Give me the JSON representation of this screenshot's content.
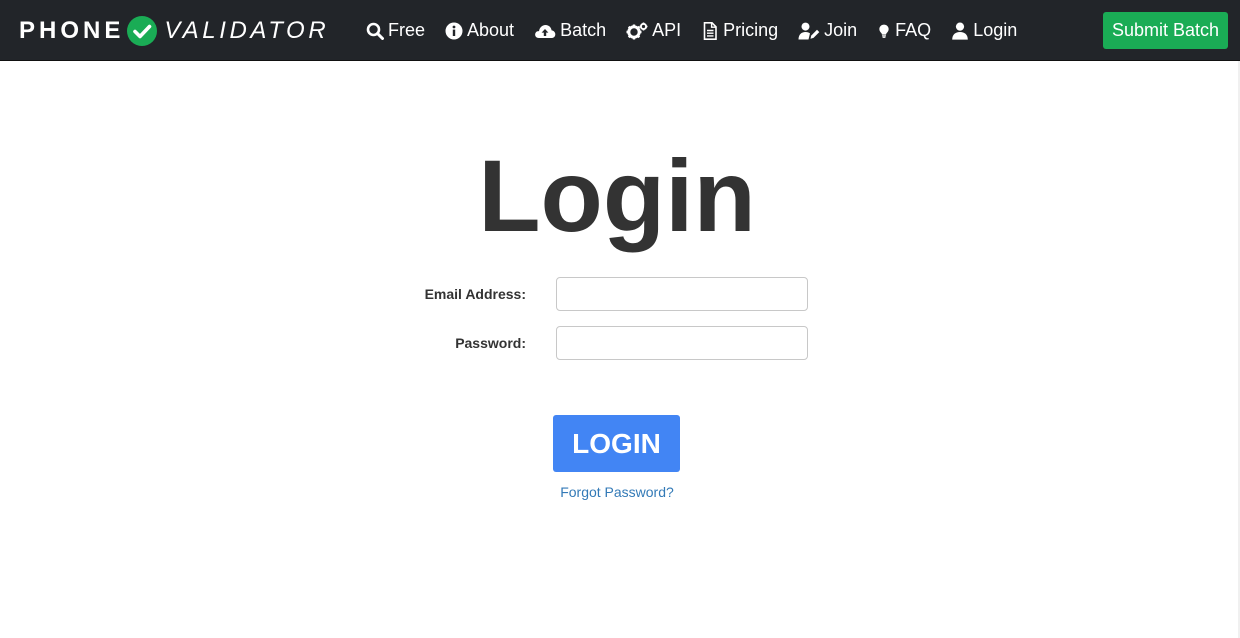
{
  "brand": {
    "word1": "PHONE",
    "word2": "VALIDATOR",
    "check_color": "#1aac55"
  },
  "nav": {
    "items": [
      {
        "label": "Free",
        "icon": "search-icon"
      },
      {
        "label": "About",
        "icon": "info-icon"
      },
      {
        "label": "Batch",
        "icon": "cloud-upload-icon"
      },
      {
        "label": "API",
        "icon": "cogs-icon"
      },
      {
        "label": "Pricing",
        "icon": "document-icon"
      },
      {
        "label": "Join",
        "icon": "user-edit-icon"
      },
      {
        "label": "FAQ",
        "icon": "lightbulb-icon"
      },
      {
        "label": "Login",
        "icon": "user-icon"
      }
    ],
    "submit_batch": "Submit Batch",
    "colors": {
      "bar": "#222529",
      "submit": "#1aac55"
    }
  },
  "page": {
    "title": "Login"
  },
  "form": {
    "email_label": "Email Address:",
    "email_value": "",
    "password_label": "Password:",
    "password_value": "",
    "login_button": "LOGIN",
    "forgot_link": "Forgot Password?"
  },
  "colors": {
    "primary_button": "#4285f4",
    "link": "#337ab7",
    "text": "#333333"
  }
}
